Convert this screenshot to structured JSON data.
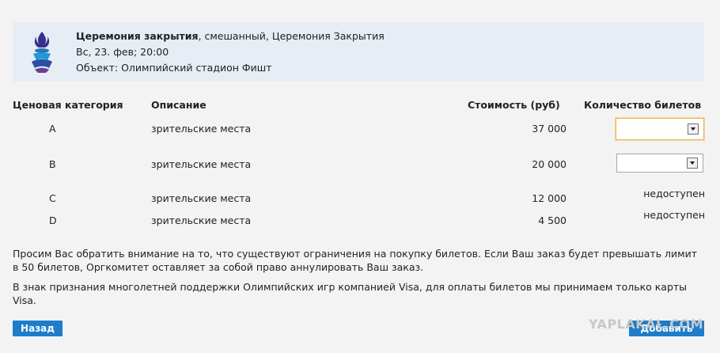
{
  "event": {
    "title_bold": "Церемония закрытия",
    "title_rest": ", смешанный, Церемония Закрытия",
    "datetime": "Вс, 23. фев; 20:00",
    "venue": "Объект: Олимпийский стадион Фишт"
  },
  "table": {
    "headers": {
      "category": "Ценовая категория",
      "description": "Описание",
      "price": "Стоимость (руб)",
      "quantity": "Количество билетов"
    },
    "rows": [
      {
        "category": "A",
        "description": "зрительские места",
        "price": "37 000",
        "status": ""
      },
      {
        "category": "B",
        "description": "зрительские места",
        "price": "20 000",
        "status": ""
      },
      {
        "category": "C",
        "description": "зрительские места",
        "price": "12 000",
        "status": "недоступен"
      },
      {
        "category": "D",
        "description": "зрительские места",
        "price": "4 500",
        "status": "недоступен"
      }
    ]
  },
  "notes": {
    "limit": "Просим Вас обратить внимание на то, что существуют ограничения на покупку билетов. Если Ваш заказ будет превышать лимит в 50 билетов, Оргкомитет оставляет за собой право аннулировать Ваш заказ.",
    "visa": "В знак признания многолетней поддержки Олимпийских игр компанией Visa, для оплаты билетов мы принимаем только карты Visa."
  },
  "buttons": {
    "back": "Назад",
    "add": "Добавить"
  },
  "watermark": "YAPLAKAL.COM",
  "icons": {
    "logo": "olympic-flame-logo",
    "select_arrow": "chevron-down-icon"
  },
  "colors": {
    "event_box": "#e6edf5",
    "button": "#1d7dc9",
    "focus_border": "#e8b54f"
  }
}
